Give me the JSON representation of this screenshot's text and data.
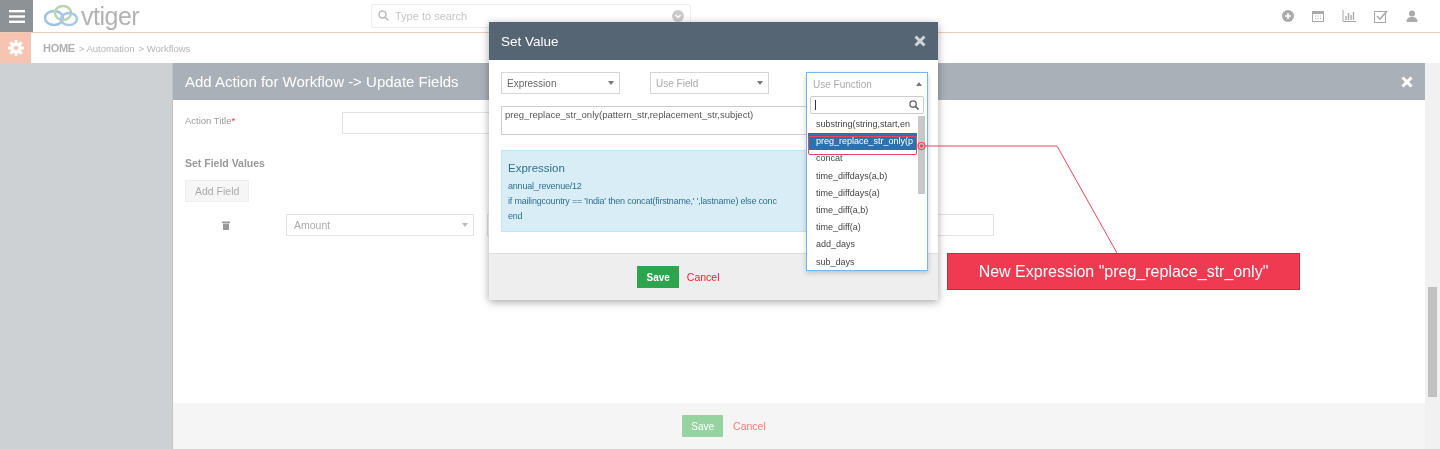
{
  "top_bar": {
    "logo": "vtiger",
    "search": {
      "placeholder": "Type to search"
    }
  },
  "breadcrumb": [
    {
      "label": "HOME",
      "kind": "home"
    },
    {
      "label": "> Automation",
      "kind": "link"
    },
    {
      "label": "> Workflows",
      "kind": "link"
    }
  ],
  "panel": {
    "title": "Add Action for Workflow -> Update Fields",
    "action_title_label": "Action Title",
    "required_mark": "*",
    "section_title": "Set Field Values",
    "add_field_button": "Add Field",
    "field_select": {
      "placeholder": "Amount"
    },
    "footer": {
      "save": {
        "label": "Save",
        "disabled": true
      },
      "cancel": "Cancel"
    }
  },
  "modal": {
    "title": "Set Value",
    "selects": [
      {
        "value": "Expression"
      },
      {
        "placeholder": "Use Field"
      }
    ],
    "function_dropdown": {
      "placeholder": "Use Function",
      "expanded": true,
      "items": [
        {
          "label": "substring(string,start,en",
          "selected": false
        },
        {
          "label": "preg_replace_str_only(p",
          "selected": true
        },
        {
          "label": "concat",
          "selected": false
        },
        {
          "label": "time_diffdays(a,b)",
          "selected": false
        },
        {
          "label": "time_diffdays(a)",
          "selected": false
        },
        {
          "label": "time_diff(a,b)",
          "selected": false
        },
        {
          "label": "time_diff(a)",
          "selected": false
        },
        {
          "label": "add_days",
          "selected": false
        },
        {
          "label": "sub_days",
          "selected": false
        }
      ]
    },
    "expression_value": "preg_replace_str_only(pattern_str,replacement_str,subject)",
    "help": {
      "title": "Expression",
      "lines": [
        "annual_revenue/12",
        "if mailingcountry == 'India' then concat(firstname,' ',lastname) else conc",
        "end"
      ]
    },
    "save": "Save",
    "cancel": "Cancel"
  },
  "annotation": {
    "text": "New Expression \"preg_replace_str_only\""
  }
}
